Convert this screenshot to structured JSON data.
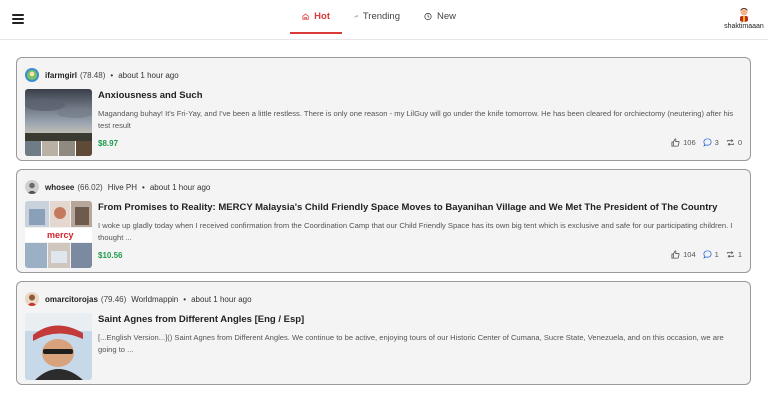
{
  "header": {
    "tabs": [
      {
        "label": "Hot",
        "icon": "home-icon",
        "active": true
      },
      {
        "label": "Trending",
        "icon": "trending-icon",
        "active": false
      },
      {
        "label": "New",
        "icon": "clock-icon",
        "active": false
      }
    ],
    "user": {
      "name": "shaktimaaan"
    }
  },
  "posts": [
    {
      "author": "ifarmgirl",
      "reputation": "(78.48)",
      "community": "",
      "time": "about 1 hour ago",
      "title": "Anxiousness and Such",
      "body": "Magandang buhay! It's Fri-Yay, and I've been a little restless. There is only one reason - my LilGuy will go under the knife tomorrow. He has been cleared for orchiectomy (neutering) after his test result",
      "payout": "$8.97",
      "likes": "106",
      "comments": "3",
      "reblogs": "0"
    },
    {
      "author": "whosee",
      "reputation": "(66.02)",
      "community": "Hive PH",
      "time": "about 1 hour ago",
      "title": "From Promises to Reality: MERCY Malaysia's Child Friendly Space Moves to Bayanihan Village and We Met The President of The Country",
      "body": "I woke up gladly today when I received confirmation from the Coordination Camp that our Child Friendly Space has its own big tent which is exclusive and safe for our participating children. I thought ...",
      "payout": "$10.56",
      "likes": "104",
      "comments": "1",
      "reblogs": "1",
      "thumb_text": "mercy"
    },
    {
      "author": "omarcitorojas",
      "reputation": "(79.46)",
      "community": "Worldmappin",
      "time": "about 1 hour ago",
      "title": "Saint Agnes from Different Angles [Eng / Esp]",
      "body": "[...English Version...]() Saint Agnes from Different Angles. We continue to be active, enjoying tours of our Historic Center of Cumana, Sucre State, Venezuela, and on this occasion, we are going to ...",
      "payout": "",
      "likes": "",
      "comments": "",
      "reblogs": ""
    }
  ]
}
